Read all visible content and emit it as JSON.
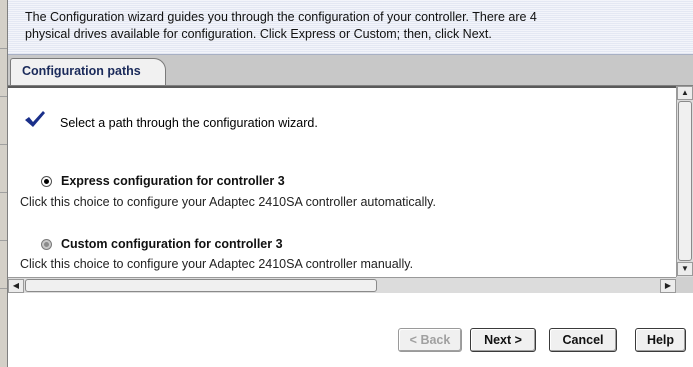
{
  "wizard": {
    "description_line1": "The Configuration wizard guides you through the configuration of your controller. There are 4",
    "description_line2": "physical drives available for configuration. Click Express or Custom; then, click Next.",
    "tab_label": "Configuration paths",
    "intro_text": "Select a path through the configuration wizard.",
    "options": [
      {
        "title": "Express configuration for controller 3",
        "description": "Click this choice to configure your Adaptec 2410SA controller automatically.",
        "selected": true
      },
      {
        "title": "Custom configuration for controller 3",
        "description": "Click this choice to configure your Adaptec 2410SA controller manually.",
        "selected": false
      }
    ]
  },
  "buttons": {
    "back": "< Back",
    "next": "Next >",
    "cancel": "Cancel",
    "help": "Help"
  },
  "icons": {
    "intro": "checkmark-icon",
    "scroll_up": "arrow-up-icon",
    "scroll_down": "arrow-down-icon",
    "scroll_left": "arrow-left-icon",
    "scroll_right": "arrow-right-icon"
  },
  "colors": {
    "checkmark": "#1a2f8a",
    "tab_text": "#1a2a5a",
    "banner_bg": "#e4e8f3"
  }
}
